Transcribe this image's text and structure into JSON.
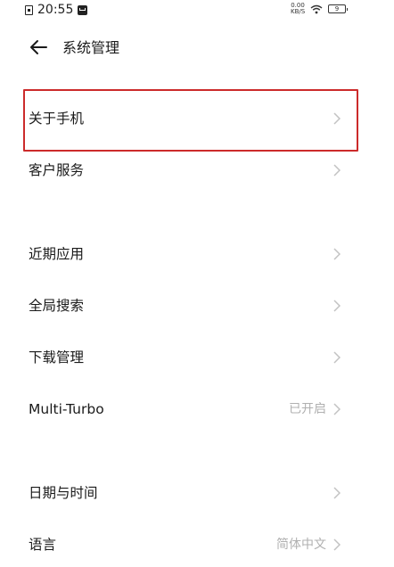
{
  "status_bar": {
    "time": "20:55",
    "net_speed_top": "0.00",
    "net_speed_bottom": "KB/S",
    "battery": "9"
  },
  "header": {
    "title": "系统管理"
  },
  "rows": [
    {
      "label": "关于手机",
      "value": ""
    },
    {
      "label": "客户服务",
      "value": ""
    },
    {
      "label": "近期应用",
      "value": ""
    },
    {
      "label": "全局搜索",
      "value": ""
    },
    {
      "label": "下载管理",
      "value": ""
    },
    {
      "label": "Multi-Turbo",
      "value": "已开启"
    },
    {
      "label": "日期与时间",
      "value": ""
    },
    {
      "label": "语言",
      "value": "简体中文"
    }
  ],
  "highlight_color": "#cc2b2b"
}
